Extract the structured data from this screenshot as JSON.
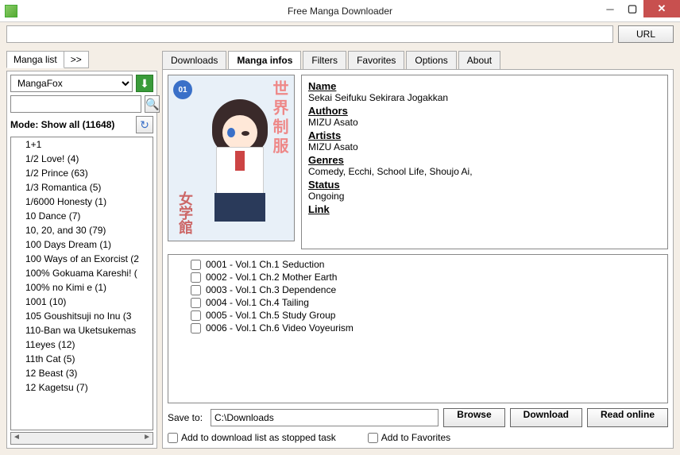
{
  "window": {
    "title": "Free Manga Downloader"
  },
  "urlbar": {
    "value": "",
    "btn": "URL"
  },
  "left": {
    "tabs": [
      "Manga list",
      ">>"
    ],
    "source": "MangaFox",
    "search": "",
    "mode": "Mode: Show all (11648)",
    "items": [
      "1+1",
      "1/2 Love! (4)",
      "1/2 Prince (63)",
      "1/3 Romantica (5)",
      "1/6000 Honesty (1)",
      "10 Dance (7)",
      "10, 20, and 30 (79)",
      "100 Days Dream (1)",
      "100 Ways of an Exorcist (2",
      "100% Gokuama Kareshi! (",
      "100% no Kimi e (1)",
      "1001 (10)",
      "105 Goushitsuji no Inu (3",
      "110-Ban wa Uketsukemas",
      "11eyes (12)",
      "11th Cat (5)",
      "12 Beast (3)",
      "12 Kagetsu (7)"
    ]
  },
  "tabs": [
    "Downloads",
    "Manga infos",
    "Filters",
    "Favorites",
    "Options",
    "About"
  ],
  "activeTab": 1,
  "info": {
    "name_lbl": "Name",
    "name": "Sekai Seifuku Sekirara Jogakkan",
    "authors_lbl": "Authors",
    "authors": "MIZU Asato",
    "artists_lbl": "Artists",
    "artists": "MIZU Asato",
    "genres_lbl": "Genres",
    "genres": "Comedy, Ecchi, School Life, Shoujo Ai,",
    "status_lbl": "Status",
    "status": "Ongoing",
    "link_lbl": "Link"
  },
  "cover": {
    "bubble": "01",
    "side": "世界制服",
    "side2": "女学館"
  },
  "chapters": [
    "0001 - Vol.1 Ch.1 Seduction",
    "0002 - Vol.1 Ch.2 Mother Earth",
    "0003 - Vol.1 Ch.3 Dependence",
    "0004 - Vol.1 Ch.4 Tailing",
    "0005 - Vol.1 Ch.5 Study Group",
    "0006 - Vol.1 Ch.6 Video Voyeurism"
  ],
  "save": {
    "label": "Save to:",
    "path": "C:\\Downloads",
    "browse": "Browse",
    "download": "Download",
    "readonline": "Read online"
  },
  "checks": {
    "stopped": "Add to download list as stopped task",
    "fav": "Add to Favorites"
  }
}
